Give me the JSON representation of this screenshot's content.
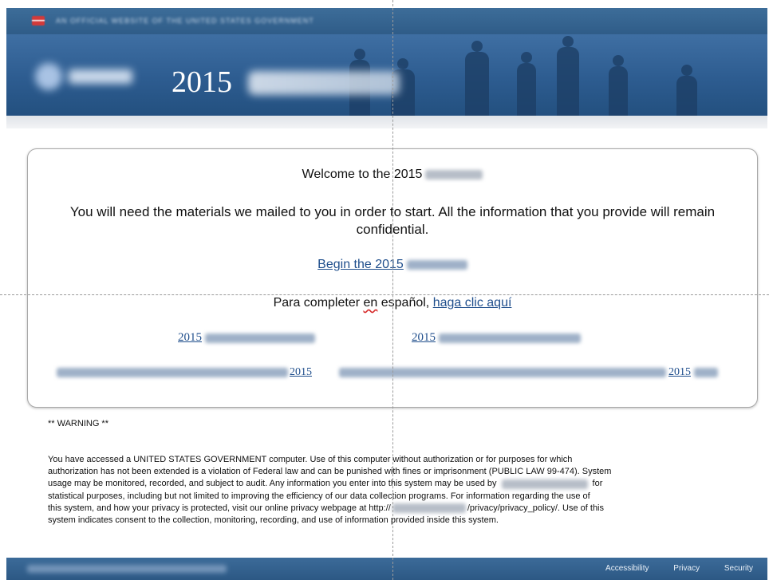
{
  "header": {
    "year": "2015"
  },
  "card": {
    "welcome": "Welcome to the 2015",
    "intro": "You will need the materials we mailed to you in order to start. All the information that you provide will remain confidential.",
    "begin_link": "Begin the 2015",
    "spanish_prefix": "Para completer ",
    "spanish_en": "en",
    "spanish_espanol": " español",
    "spanish_comma": ", ",
    "spanish_link": "haga clic aquí",
    "lang_links": [
      {
        "label": "2015"
      },
      {
        "label": "2015"
      },
      {
        "label": "2015"
      },
      {
        "label": "2015"
      }
    ]
  },
  "warning": {
    "heading": "** WARNING **",
    "line1": "You have accessed a UNITED STATES GOVERNMENT computer. Use of this computer without authorization or for purposes for which",
    "line2": "authorization has not been extended is a violation of Federal law and can be punished with fines or imprisonment (PUBLIC LAW 99-474). System",
    "line3a": "usage may be monitored, recorded, and subject to audit. Any information you enter into this system may be used by",
    "line3b": "for",
    "line4": "statistical purposes, including but not limited to improving the efficiency of our data collection programs. For information regarding the use of",
    "line5a": "this system, and how your privacy is protected, visit our online privacy webpage at http://",
    "line5b": "/privacy/privacy_policy/. Use of this",
    "line6": "system indicates consent to the collection, monitoring, recording, and use of information provided inside this system."
  },
  "footer": {
    "accessibility": "Accessibility",
    "privacy": "Privacy",
    "security": "Security"
  },
  "colors": {
    "header": "#2d5c90",
    "link": "#1f4e8c",
    "footer": "#2c5884"
  }
}
